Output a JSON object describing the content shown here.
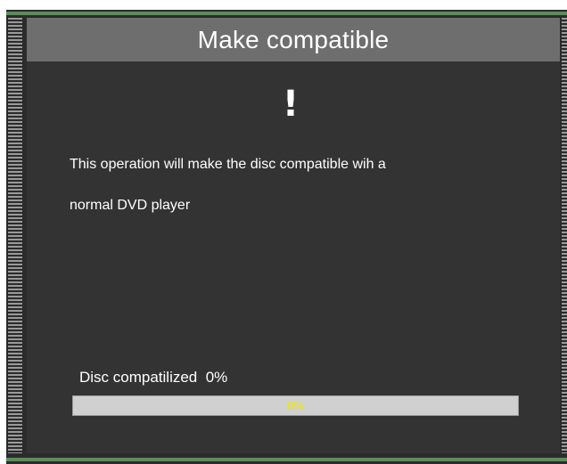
{
  "dialog": {
    "title": "Make compatible",
    "alert_symbol": "!",
    "alert_icon": "exclamation-icon",
    "message_line1": "This operation will make the disc compatible wih a",
    "message_line2": "normal DVD  player"
  },
  "progress": {
    "label": "Disc compatilized  0%",
    "percent_text": "0%",
    "fraction": 0
  },
  "colors": {
    "accent_line": "#5f8b5c",
    "title_bar": "#6e6e6e",
    "panel": "#333333",
    "progress_text": "#f2e600",
    "progress_track": "#d0d0d0"
  }
}
